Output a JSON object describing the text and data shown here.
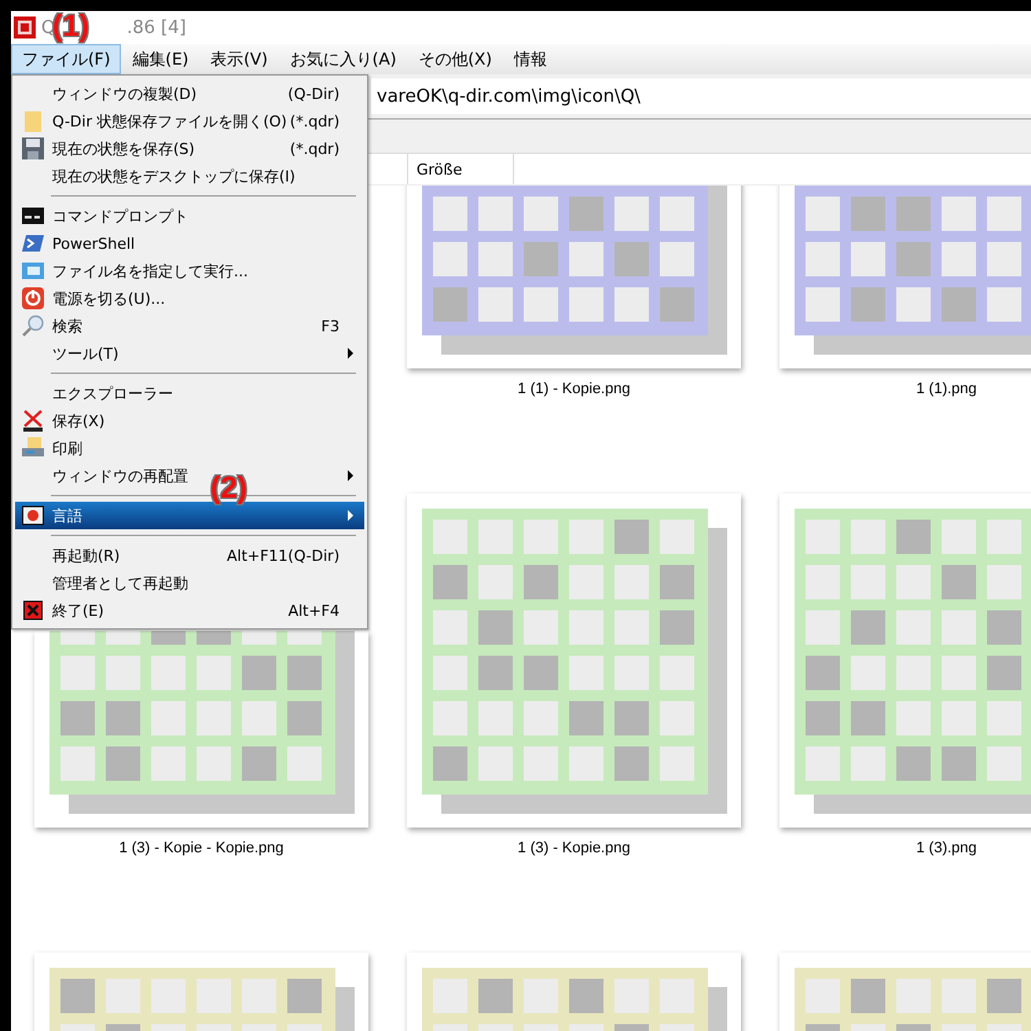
{
  "window": {
    "title_start": "Q",
    "title_end": ".86 [4]"
  },
  "menubar": [
    {
      "label": "ファイル(F)",
      "selected": true
    },
    {
      "label": "編集(E)",
      "selected": false
    },
    {
      "label": "表示(V)",
      "selected": false
    },
    {
      "label": "お気に入り(A)",
      "selected": false
    },
    {
      "label": "その他(X)",
      "selected": false
    },
    {
      "label": "情報",
      "selected": false
    }
  ],
  "address": {
    "value": "vareOK\\q-dir.com\\img\\icon\\Q\\"
  },
  "columns": [
    "Größe"
  ],
  "files": [
    {
      "label": "1 (1) - Kopie.png",
      "color": "#bcbcec"
    },
    {
      "label": "1 (1).png",
      "color": "#bcbcec"
    },
    {
      "label": "1 (3) - Kopie - Kopie.png",
      "color": "#c6eabc"
    },
    {
      "label": "1 (3) - Kopie.png",
      "color": "#c6eabc"
    },
    {
      "label": "1 (3).png",
      "color": "#c6eabc"
    },
    {
      "color": "#e8e6bc"
    },
    {
      "color": "#e8e6bc"
    },
    {
      "color": "#e8e6bc"
    }
  ],
  "menu": [
    {
      "kind": "item",
      "label": "ウィンドウの複製(D)",
      "shortcut": "(Q-Dir)",
      "submenu": false,
      "selected": false
    },
    {
      "kind": "item",
      "label": "Q-Dir 状態保存ファイルを開く(O)",
      "shortcut": "(*.qdr)",
      "submenu": false,
      "selected": false
    },
    {
      "kind": "item",
      "label": "現在の状態を保存(S)",
      "shortcut": "(*.qdr)",
      "submenu": false,
      "selected": false
    },
    {
      "kind": "item",
      "label": "現在の状態をデスクトップに保存(I)",
      "submenu": false,
      "selected": false
    },
    {
      "kind": "separator"
    },
    {
      "kind": "item",
      "label": "コマンドプロンプト",
      "submenu": false,
      "selected": false
    },
    {
      "kind": "item",
      "label": "PowerShell",
      "submenu": false,
      "selected": false
    },
    {
      "kind": "item",
      "label": "ファイル名を指定して実行...",
      "submenu": false,
      "selected": false
    },
    {
      "kind": "item",
      "label": "電源を切る(U)...",
      "submenu": false,
      "selected": false
    },
    {
      "kind": "item",
      "label": "検索",
      "shortcut": "F3",
      "submenu": false,
      "selected": false
    },
    {
      "kind": "item",
      "label": "ツール(T)",
      "submenu": true,
      "selected": false
    },
    {
      "kind": "separator"
    },
    {
      "kind": "item",
      "label": "エクスプローラー",
      "submenu": false,
      "selected": false
    },
    {
      "kind": "item",
      "label": "保存(X)",
      "submenu": false,
      "selected": false
    },
    {
      "kind": "item",
      "label": "印刷",
      "submenu": false,
      "selected": false
    },
    {
      "kind": "item",
      "label": "ウィンドウの再配置",
      "submenu": true,
      "selected": false
    },
    {
      "kind": "separator"
    },
    {
      "kind": "item",
      "label": "言語",
      "submenu": true,
      "selected": true
    },
    {
      "kind": "separator"
    },
    {
      "kind": "item",
      "label": "再起動(R)",
      "shortcut": "Alt+F11(Q-Dir)",
      "submenu": false,
      "selected": false
    },
    {
      "kind": "item",
      "label": "管理者として再起動",
      "submenu": false,
      "selected": false
    },
    {
      "kind": "item",
      "label": "終了(E)",
      "shortcut": "Alt+F4",
      "submenu": false,
      "selected": false
    }
  ],
  "annotations": [
    "(1)",
    "(2)"
  ]
}
